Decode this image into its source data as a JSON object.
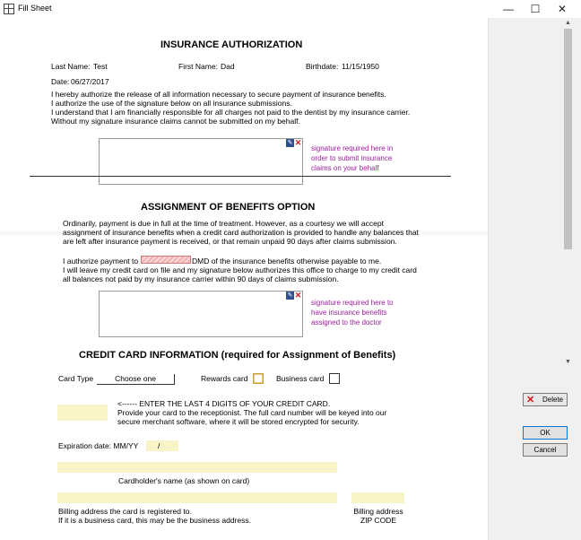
{
  "window": {
    "title": "Fill Sheet",
    "minimize": "—",
    "maximize": "☐",
    "close": "✕"
  },
  "auth": {
    "title": "INSURANCE AUTHORIZATION",
    "last_name_label": "Last Name:",
    "last_name_value": "Test",
    "first_name_label": "First Name:",
    "first_name_value": "Dad",
    "birthdate_label": "Birthdate:",
    "birthdate_value": "11/15/1950",
    "date_label": "Date:",
    "date_value": "06/27/2017",
    "lines": [
      "I hereby authorize the release of all information necessary to secure payment of insurance benefits.",
      "I authorize the use of the signature below on all insurance submissions.",
      "I understand that I am financially responsible for all charges not paid to the dentist by my insurance carrier.",
      "Without my signature insurance claims cannot be submitted on my behalf."
    ],
    "signature_note": [
      "signature required here in",
      "order to submit insurance",
      "claims on your behalf"
    ]
  },
  "assignment": {
    "title": "ASSIGNMENT OF BENEFITS OPTION",
    "lines": [
      "Ordinarily, payment is due in full at the time of treatment.  However, as a courtesy we will accept",
      "assignment of insurance benefits when a credit card authorization is provided to handle any balances that",
      "are left after insurance payment is received, or that remain unpaid 90 days after claims submission."
    ],
    "authorize_prefix": "I authorize payment to",
    "authorize_suffix": "DMD of the insurance benefits otherwise payable to me.",
    "lines2": [
      "I will leave my credit card on file and my signature below authorizes this office to charge to my credit card",
      "all balances not paid by my insurance carrier within 90 days of claims submission."
    ],
    "signature_note": [
      "signature required here to",
      "have insurance benefits",
      "assigned to the doctor"
    ]
  },
  "credit": {
    "title": "CREDIT CARD INFORMATION (required for Assignment of Benefits)",
    "card_type_label": "Card Type",
    "card_type_value": "Choose one",
    "rewards_label": "Rewards card",
    "business_label": "Business card",
    "last4_lines": [
      "<------ ENTER THE LAST 4 DIGITS OF YOUR CREDIT CARD.",
      "Provide your card to the receptionist.  The full card number will be keyed into our",
      "secure merchant software, where it will be stored encrypted for security."
    ],
    "expiration_label": "Expiration date: MM/YY",
    "expiration_sep": "/",
    "cardholder_label": "Cardholder's name (as shown on card)",
    "billing_lines": [
      "Billing address the card is registered to.",
      "If it is a business card, this may be the business address."
    ],
    "billing_zip_lines": [
      "Billing address",
      "ZIP CODE"
    ]
  },
  "buttons": {
    "delete": "Delete",
    "ok": "OK",
    "cancel": "Cancel"
  },
  "scrollbar": {
    "up": "▲",
    "down": "▼"
  },
  "colors": {
    "note_purple": "#9a1e9a",
    "field_yellow": "#f8f4c8",
    "delete_red": "#d01818"
  }
}
